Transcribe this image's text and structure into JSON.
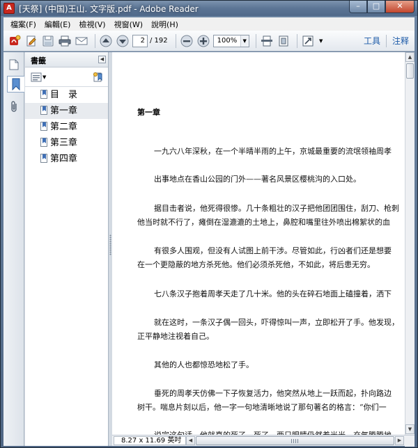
{
  "window": {
    "title": "[天祭] (中国)王山. 文字版.pdf - Adobe Reader",
    "minimize_glyph": "–",
    "maximize_glyph": "□",
    "close_glyph": "✕"
  },
  "menu": [
    "檔案(F)",
    "編輯(E)",
    "檢視(V)",
    "視窗(W)",
    "說明(H)"
  ],
  "toolbar": {
    "current_page": "2",
    "total_pages": "/ 192",
    "zoom": "100%",
    "tools_label": "工具",
    "comment_label": "注释",
    "icons": [
      "create-pdf-icon",
      "edit-icon",
      "save-icon",
      "print-icon",
      "email-icon",
      "page-up-icon",
      "page-down-icon",
      "zoom-out-icon",
      "zoom-in-icon",
      "fit-page-icon",
      "fit-width-icon",
      "full-screen-icon"
    ]
  },
  "bookmarks": {
    "title": "書籤",
    "items": [
      {
        "label": "目　录",
        "selected": false
      },
      {
        "label": "第一章",
        "selected": true
      },
      {
        "label": "第二章",
        "selected": false
      },
      {
        "label": "第三章",
        "selected": false
      },
      {
        "label": "第四章",
        "selected": false
      }
    ]
  },
  "document": {
    "chapter_title": "第一章",
    "paragraphs": [
      "一九六八年深秋，在一个半晴半雨的上午，京城最重要的流氓领袖周孝",
      "出事地点在香山公园的门外——著名风景区樱桃沟的入口处。",
      "据目击者说，他死得很惨。几十条粗壮的汉子把他团团围住，刮刀、枪刺",
      "他当时就不行了，瘫倒在湿漉漉的土地上，鼻腔和嘴里往外喷出棉絮状的血",
      "有很多人围观，但没有人试图上前干涉。尽管如此，行凶者们还是想要",
      "在一个更隐蔽的地方杀死他。他们必须杀死他，不如此，将后患无穷。",
      "七八条汉子抱着周孝天走了几十米。他的头在碎石地面上磕撞着，洒下",
      "就在这时，一条汉子偶一回头，吓得惊叫一声，立即松开了手。他发现，",
      "正平静地注视着自己。",
      "其他的人也都惊恐地松了手。",
      "垂死的周孝天仿佛一下子恢复活力，他突然从地上一跃而起，扑向路边",
      "树干。喘息片刻以后，他一字一句地清晰地说了那句著名的格言：“你们一",
      "说完这句话，他就真的死了。死了，两只眼睛仍然着光光，充气腾腾地"
    ]
  },
  "status": {
    "page_size": "8.27 x 11.69 英吋"
  }
}
